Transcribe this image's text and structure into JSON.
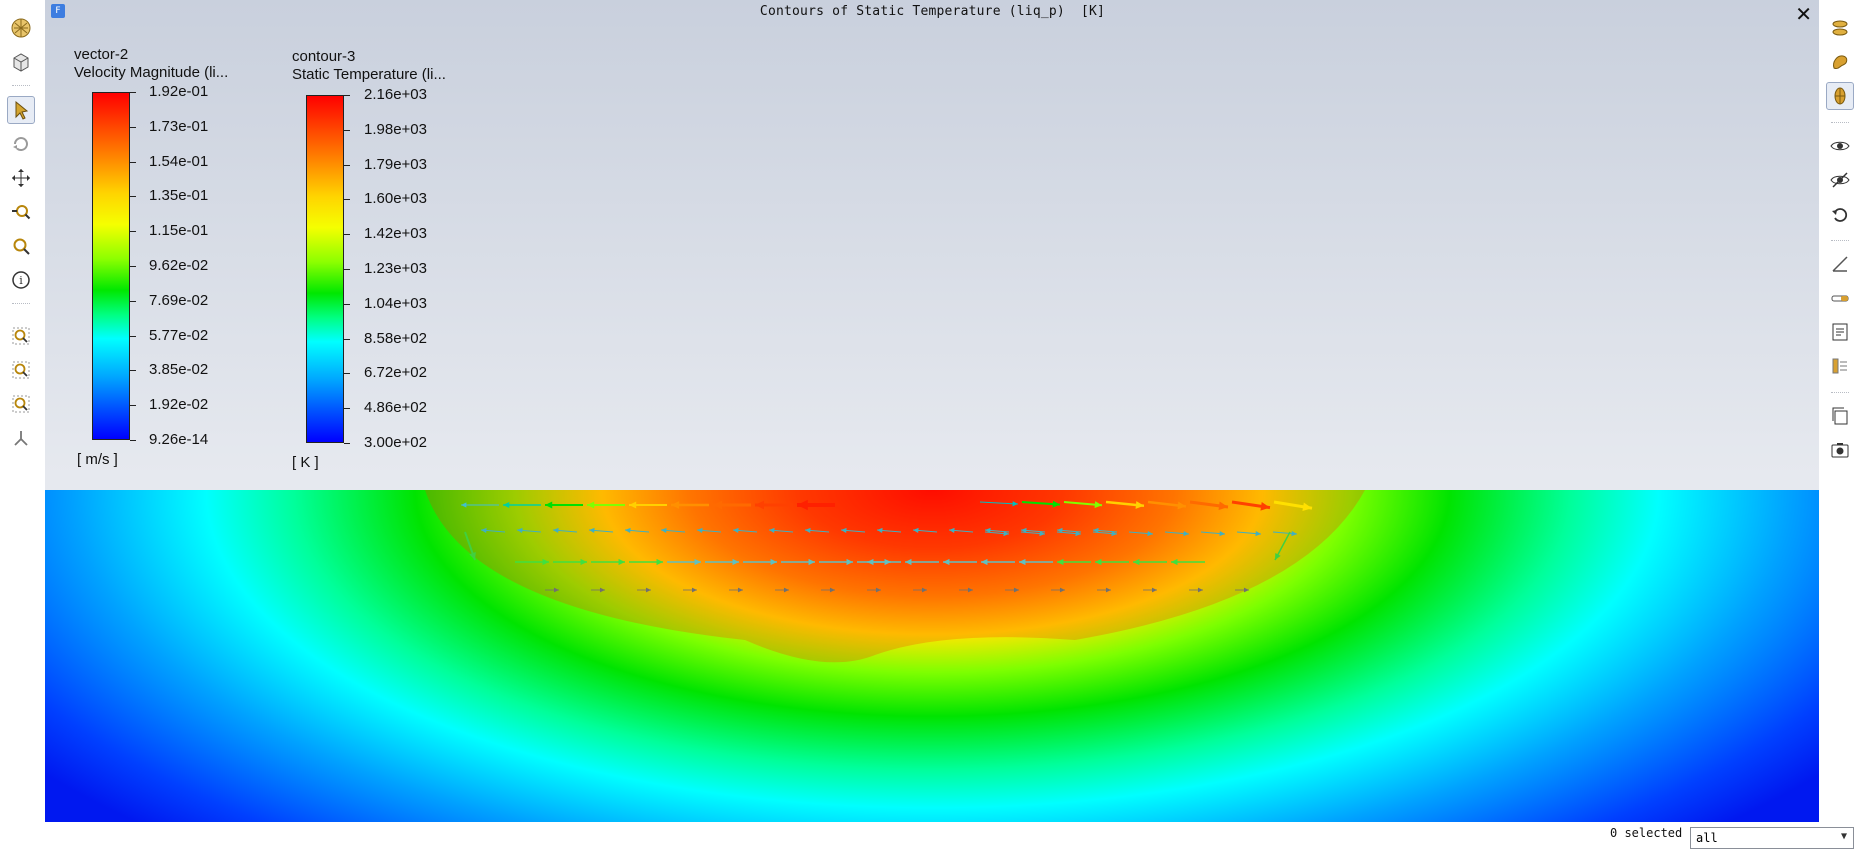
{
  "window": {
    "title": "Contours of Static Temperature (liq_p)  [K]",
    "icon_letter": "F"
  },
  "legends": [
    {
      "name": "vector-2",
      "field": "Velocity Magnitude (li...",
      "unit": "[ m/s ]",
      "labels": [
        "1.92e-01",
        "1.73e-01",
        "1.54e-01",
        "1.35e-01",
        "1.15e-01",
        "9.62e-02",
        "7.69e-02",
        "5.77e-02",
        "3.85e-02",
        "1.92e-02",
        "9.26e-14"
      ]
    },
    {
      "name": "contour-3",
      "field": "Static Temperature (li...",
      "unit": "[ K ]",
      "labels": [
        "2.16e+03",
        "1.98e+03",
        "1.79e+03",
        "1.60e+03",
        "1.42e+03",
        "1.23e+03",
        "1.04e+03",
        "8.58e+02",
        "6.72e+02",
        "4.86e+02",
        "3.00e+02"
      ]
    }
  ],
  "left_toolbar": [
    "fit-to-window-icon",
    "isometric-view-icon",
    "select-pointer-icon",
    "rotate-icon",
    "pan-icon",
    "zoom-in-out-icon",
    "zoom-to-area-icon",
    "probe-info-icon",
    "zoom-fit-icon",
    "zoom-in-icon",
    "zoom-out-icon",
    "axes-triad-icon"
  ],
  "right_toolbar": [
    "clip-plane-icon",
    "surface-view-icon",
    "mesh-view-icon",
    "hide-icon",
    "show-icon",
    "undo-view-icon",
    "ruler-icon",
    "colormap-bar-icon",
    "annotation-icon",
    "legend-toggle-icon",
    "copy-image-icon",
    "screenshot-icon"
  ],
  "status": {
    "selected_text": "0 selected",
    "filter_value": "all"
  },
  "colors": {
    "hot": "#ff0000",
    "warm": "#ff8000",
    "mid": "#00e800",
    "cool": "#00ffff",
    "cold": "#0030ff"
  }
}
